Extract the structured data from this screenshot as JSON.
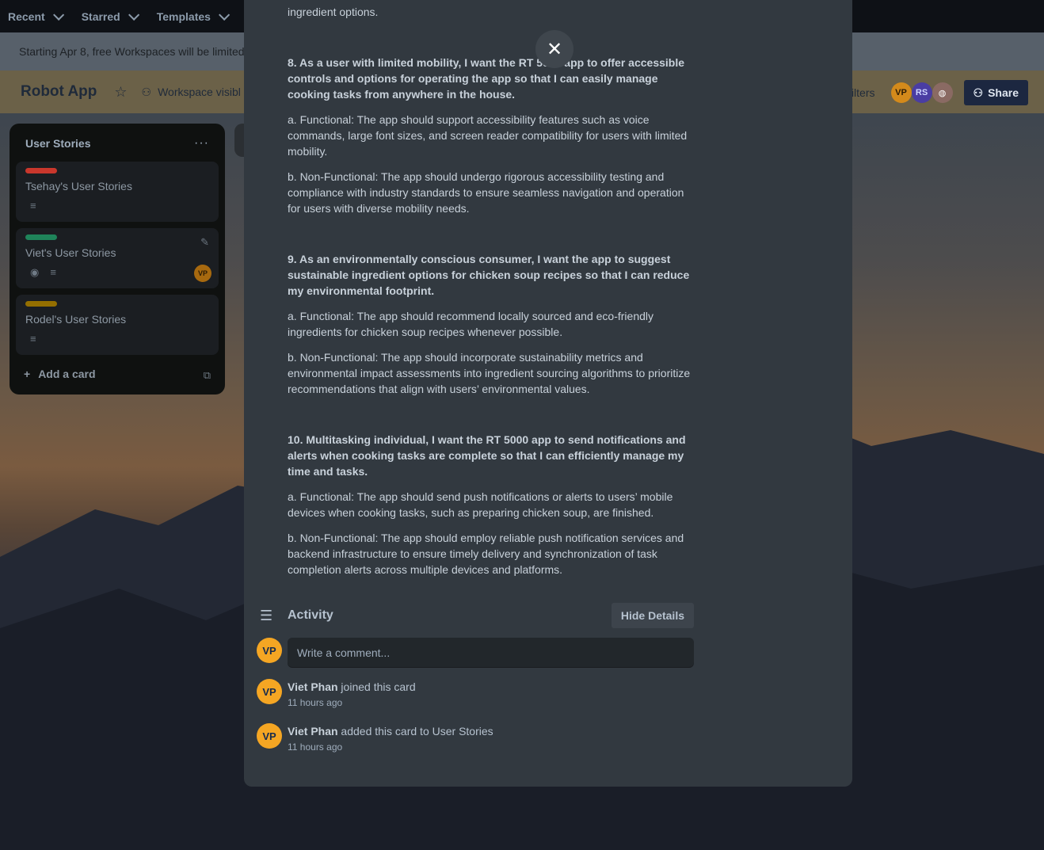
{
  "topnav": {
    "items": [
      {
        "label": "Recent"
      },
      {
        "label": "Starred"
      },
      {
        "label": "Templates"
      }
    ]
  },
  "banner": {
    "text": "Starting Apr 8, free Workspaces will be limited"
  },
  "board": {
    "title": "Robot App",
    "visibility": "Workspace visibl",
    "filters": "Filters",
    "members": [
      "VP",
      "RS"
    ],
    "share": "Share"
  },
  "list": {
    "title": "User Stories",
    "cards": [
      {
        "title": "Tsehay's User Stories",
        "label_color": "#c9372c"
      },
      {
        "title": "Viet's User Stories",
        "label_color": "#1f845a",
        "member": "VP"
      },
      {
        "title": "Rodel's User Stories",
        "label_color": "#946f00"
      }
    ],
    "add_card": "Add a card"
  },
  "modal": {
    "intro_tail": "ingredient options.",
    "stories": [
      {
        "question": "8. As a user with limited mobility, I want the RT 5000 app to offer accessible controls and options for operating the app so that I can easily manage cooking tasks from anywhere in the house.",
        "functional": "a. Functional: The app should support accessibility features such as voice commands, large font sizes, and screen reader compatibility for users with limited mobility.",
        "nonfunctional": "b. Non-Functional: The app should undergo rigorous accessibility testing and compliance with industry standards to ensure seamless navigation and operation for users with diverse mobility needs."
      },
      {
        "question": "9. As an environmentally conscious consumer, I want the app to suggest sustainable ingredient options for chicken soup recipes so that I can reduce my environmental footprint.",
        "functional": "a. Functional: The app should recommend locally sourced and eco-friendly ingredients for chicken soup recipes whenever possible.",
        "nonfunctional": "b. Non-Functional: The app should incorporate sustainability metrics and environmental impact assessments into ingredient sourcing algorithms to prioritize recommendations that align with users’ environmental values."
      },
      {
        "question": "10. Multitasking individual, I want the RT 5000 app to send notifications and alerts when cooking tasks are complete so that I can efficiently manage my time and tasks.",
        "functional": "a. Functional: The app should send push notifications or alerts to users’ mobile devices when cooking tasks, such as preparing chicken soup, are finished.",
        "nonfunctional": "b. Non-Functional: The app should employ reliable push notification services and backend infrastructure to ensure timely delivery and synchronization of task completion alerts across multiple devices and platforms."
      }
    ],
    "activity": {
      "title": "Activity",
      "hide_details": "Hide Details",
      "comment_placeholder": "Write a comment...",
      "user_initials": "VP",
      "entries": [
        {
          "user": "Viet Phan",
          "action": " joined this card",
          "time": "11 hours ago",
          "initials": "VP"
        },
        {
          "user": "Viet Phan",
          "action": " added this card to User Stories",
          "time": "11 hours ago",
          "initials": "VP"
        }
      ]
    }
  }
}
